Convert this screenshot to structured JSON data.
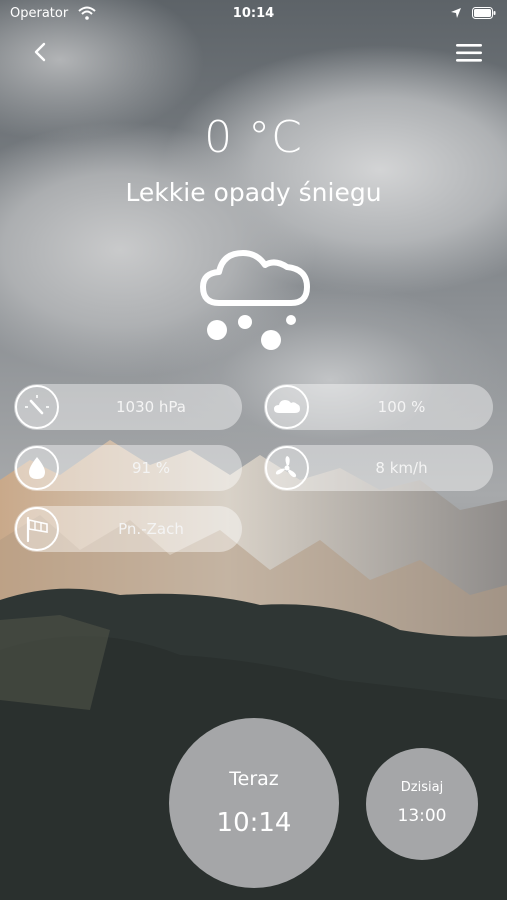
{
  "status_bar": {
    "carrier": "Operator",
    "time": "10:14"
  },
  "weather": {
    "temperature": "0 °C",
    "condition": "Lekkie opady śniegu",
    "icon": "snow-cloud-icon"
  },
  "stats": {
    "pressure": "1030 hPa",
    "cloudiness": "100 %",
    "humidity": "91 %",
    "wind_speed": "8 km/h",
    "wind_direction": "Pn.-Zach"
  },
  "time_buttons": {
    "now_label": "Teraz",
    "now_time": "10:14",
    "today_label": "Dzisiaj",
    "today_time": "13:00"
  },
  "colors": {
    "text": "#ffffff",
    "pill_background": "rgba(255,255,255,0.42)",
    "circle_background": "rgba(200,200,202,0.78)"
  }
}
